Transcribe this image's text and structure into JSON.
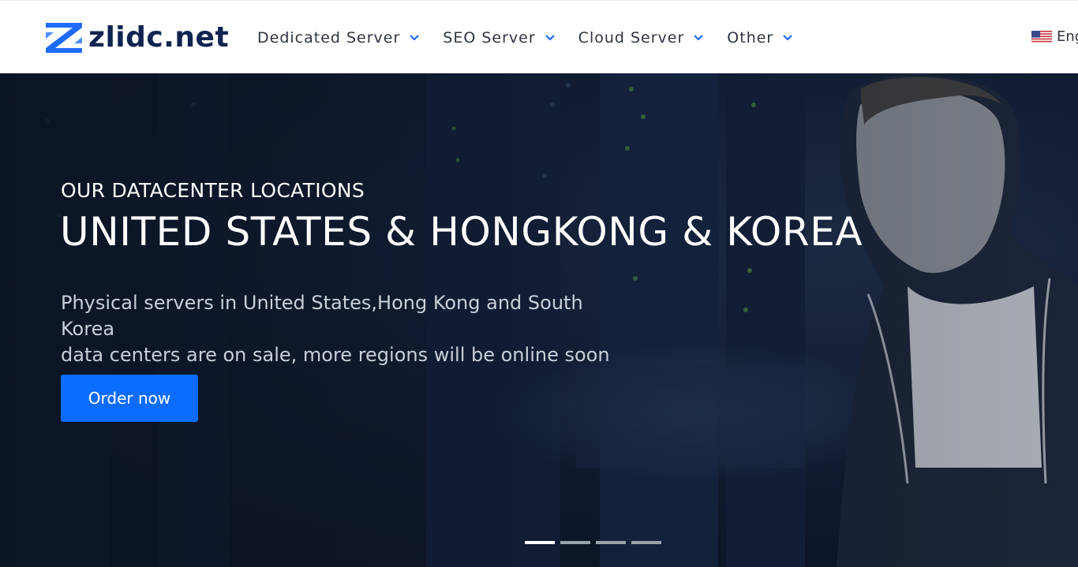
{
  "header": {
    "logo_text": "zlidc.net",
    "nav": [
      {
        "label": "Dedicated Server"
      },
      {
        "label": "SEO Server"
      },
      {
        "label": "Cloud Server"
      },
      {
        "label": "Other"
      }
    ],
    "language": "Eng"
  },
  "hero": {
    "eyebrow": "OUR DATACENTER LOCATIONS",
    "headline": "UNITED STATES & HONGKONG & KOREA",
    "description_line1": "Physical servers in United States,Hong Kong and South Korea",
    "description_line2": "data centers are on sale, more regions will be online soon",
    "cta_label": "Order now",
    "slide_count": 4,
    "active_slide": 1
  },
  "colors": {
    "brand_blue": "#1e6bff",
    "logo_text": "#0f2450",
    "cta_bg": "#0b6cff",
    "hero_bg": "#0d1628"
  },
  "icons": {
    "logo": "zl-logo-mark",
    "nav_dropdown": "chevron-down-icon",
    "language_flag": "us-flag-icon"
  }
}
